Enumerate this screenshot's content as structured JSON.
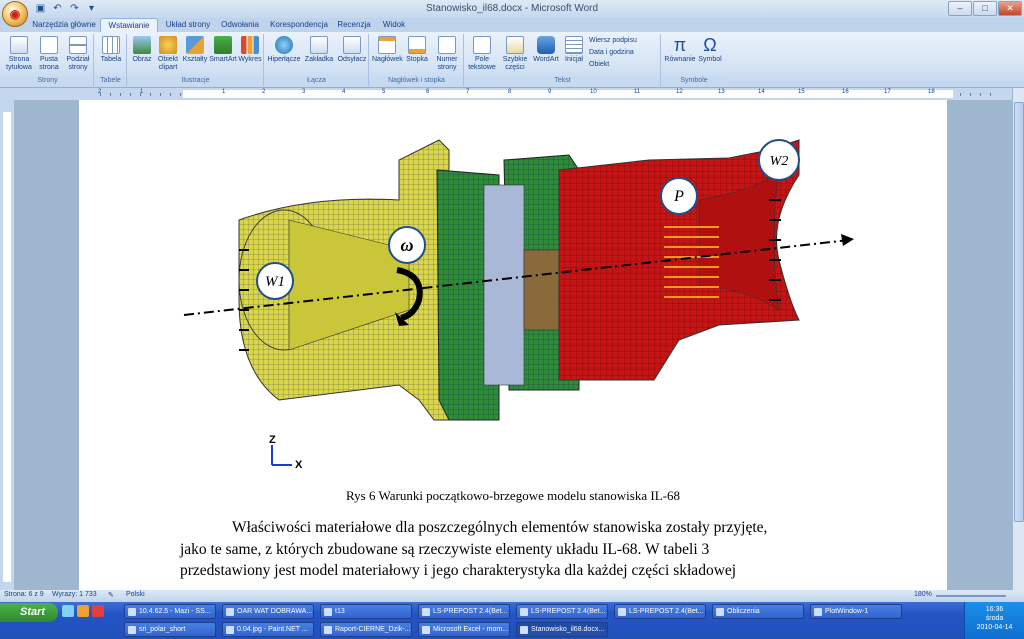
{
  "window": {
    "title": "Stanowisko_il68.docx - Microsoft Word"
  },
  "tabs": [
    "Narzędzia główne",
    "Wstawianie",
    "Układ strony",
    "Odwołania",
    "Korespondencja",
    "Recenzja",
    "Widok"
  ],
  "active_tab": "Wstawianie",
  "ribbon": {
    "groups": [
      {
        "label": "Strony",
        "buttons": [
          "Strona tytułowa",
          "Pusta strona",
          "Podział strony"
        ]
      },
      {
        "label": "Tabele",
        "buttons": [
          "Tabela"
        ]
      },
      {
        "label": "Ilustracje",
        "buttons": [
          "Obraz",
          "Obiekt clipart",
          "Kształty",
          "SmartArt",
          "Wykres"
        ]
      },
      {
        "label": "Łącza",
        "buttons": [
          "Hiperłącze",
          "Zakładka",
          "Odsyłacz"
        ]
      },
      {
        "label": "Nagłówek i stopka",
        "buttons": [
          "Nagłówek",
          "Stopka",
          "Numer strony"
        ]
      },
      {
        "label": "Tekst",
        "buttons": [
          "Pole tekstowe",
          "Szybkie części",
          "WordArt",
          "Inicjał"
        ],
        "small": [
          "Wiersz podpisu",
          "Data i godzina",
          "Obiekt"
        ]
      },
      {
        "label": "Symbole",
        "buttons": [
          "Równanie",
          "Symbol"
        ]
      }
    ]
  },
  "figure": {
    "labels": {
      "w1": "W1",
      "w2": "W2",
      "omega": "ω",
      "p": "P"
    },
    "axes": {
      "z": "Z",
      "x": "X"
    },
    "colors": {
      "yellow": "#d9d64a",
      "green": "#2e8b3a",
      "red": "#c41414",
      "orange": "#f39a1e",
      "grid": "#555555"
    }
  },
  "document": {
    "caption": "Rys 6 Warunki początkowo-brzegowe modelu stanowiska IL-68",
    "lines": [
      "Właściwości materiałowe dla poszczególnych elementów stanowiska zostały przyjęte,",
      "jako te same, z których zbudowane są rzeczywiste elementy układu IL-68. W tabeli 3",
      "przedstawiony jest model materiałowy i jego charakterystyka dla każdej części składowej"
    ]
  },
  "ruler": {
    "numbers": [
      "2",
      "1",
      "1",
      "2",
      "3",
      "4",
      "5",
      "6",
      "7",
      "8",
      "9",
      "10",
      "11",
      "12",
      "13",
      "14",
      "15",
      "16",
      "17",
      "18"
    ]
  },
  "status": {
    "page": "Strona: 6 z 9",
    "words": "Wyrazy: 1 733",
    "lang": "Polski",
    "zoom": "180%"
  },
  "taskbar": {
    "start": "Start",
    "row1": [
      "10.4.62.5 - Mazi - SS...",
      "OAR WAT DOBRAWA...",
      "t13",
      "LS-PREPOST 2.4(Bet...",
      "LS-PREPOST 2.4(Bet...",
      "LS-PREPOST 2.4(Bet...",
      "Obliczenia",
      "PlotWindow-1"
    ],
    "row2": [
      "sri_polar_short",
      "0.04.jpg - Paint.NET ...",
      "Raport-CIERNE_Dzik-...",
      "Microsoft Excel - mom...",
      "Stanowisko_il68.docx..."
    ],
    "time": "16:36",
    "day": "środa",
    "date": "2010-04-14"
  }
}
